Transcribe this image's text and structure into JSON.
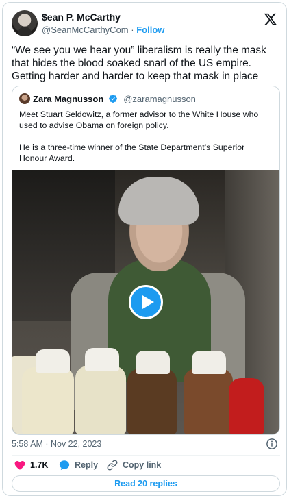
{
  "author": {
    "name": "$ean P. McCarthy",
    "handle": "@SeanMcCarthyCom",
    "separator": "·",
    "follow_label": "Follow"
  },
  "tweet": {
    "text": "“We see you we hear you” liberalism is really the mask that hides the blood soaked snarl of the US empire. Getting harder and harder to keep that mask in place"
  },
  "quoted": {
    "name": "Zara Magnusson",
    "handle": "@zaramagnusson",
    "paragraph1": "Meet Stuart Seldowitz, a former advisor to the White House who used to advise Obama on foreign policy.",
    "paragraph2": "He is a three-time winner of the State Department’s Superior Honour Award."
  },
  "meta": {
    "timestamp": "5:58 AM · Nov 22, 2023"
  },
  "actions": {
    "likes": "1.7K",
    "reply_label": "Reply",
    "copy_label": "Copy link",
    "read_replies": "Read 20 replies"
  },
  "icons": {
    "logo": "x-logo-icon",
    "verified": "verified-badge-icon",
    "play": "play-icon",
    "info": "info-icon",
    "like": "heart-icon",
    "reply": "reply-bubble-icon",
    "copy": "link-icon"
  },
  "colors": {
    "accent": "#1d9bf0",
    "like": "#f91880",
    "text": "#0f1419",
    "muted": "#536471"
  }
}
